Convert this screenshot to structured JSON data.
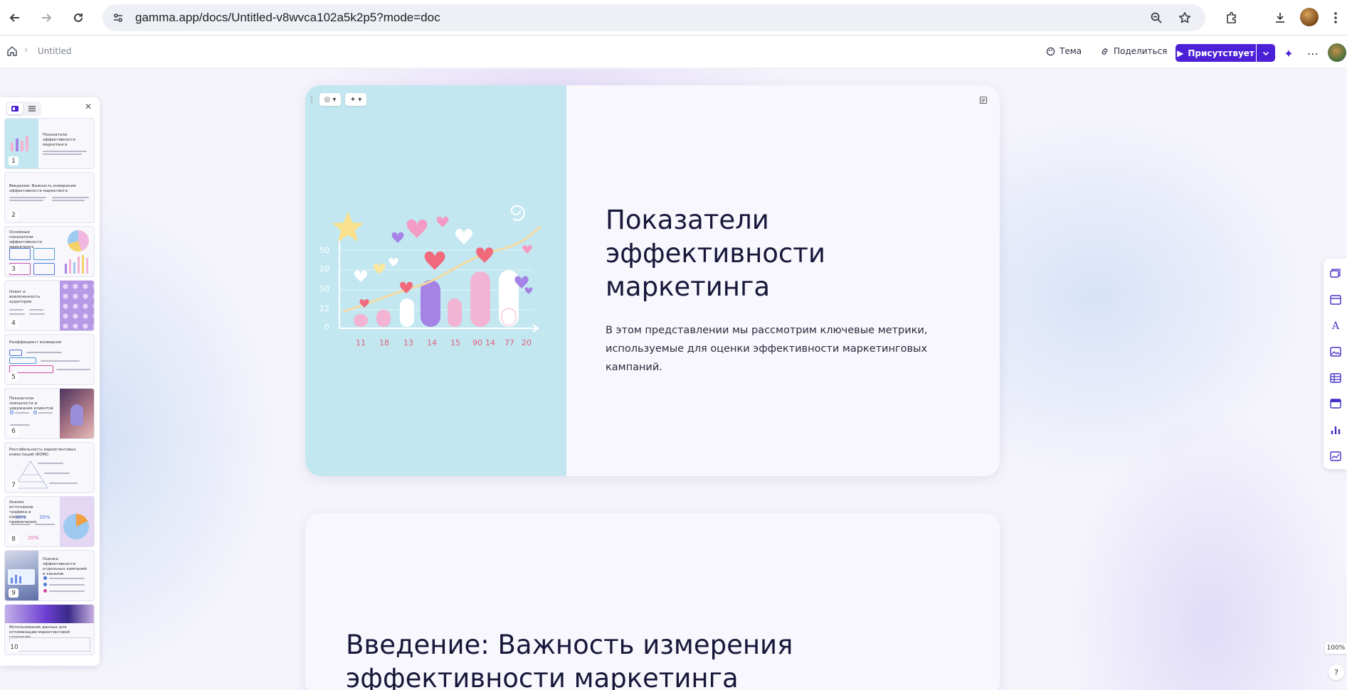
{
  "browser": {
    "url": "gamma.app/docs/Untitled-v8wvca102a5k2p5?mode=doc",
    "icons": [
      "back-icon",
      "forward-icon",
      "reload-icon",
      "site-settings-icon",
      "zoom-icon",
      "bookmark-star-icon",
      "extensions-icon",
      "download-icon",
      "profile-avatar",
      "browser-menu-icon"
    ]
  },
  "appbar": {
    "breadcrumb_title": "Untitled",
    "theme_label": "Тема",
    "share_label": "Поделиться",
    "present_label": "Присутствует"
  },
  "panel": {
    "slides": [
      {
        "num": "1",
        "title": "Показатели эффективности маркетинга"
      },
      {
        "num": "2",
        "title": "Введение: Важность измерения эффективности маркетинга"
      },
      {
        "num": "3",
        "title": "Основные показатели эффективности маркетинга"
      },
      {
        "num": "4",
        "title": "Охват и вовлеченность аудитории"
      },
      {
        "num": "5",
        "title": "Коэффициент конверсии"
      },
      {
        "num": "6",
        "title": "Показатели лояльности и удержания клиентов"
      },
      {
        "num": "7",
        "title": "Рентабельность маркетинговых инвестиций (ROMI)"
      },
      {
        "num": "8",
        "title": "Анализ источников трафика и каналов привлечения",
        "stats": [
          "50%",
          "30%",
          "20%"
        ]
      },
      {
        "num": "9",
        "title": "Оценка эффективности отдельных кампаний и каналов"
      },
      {
        "num": "10",
        "title": "Использование данных для оптимизации маркетинговой стратегии"
      }
    ]
  },
  "slide1": {
    "title_lines": [
      "Показатели",
      "эффективности",
      "маркетинга"
    ],
    "description_lines": [
      "В этом представлении мы рассмотрим ключевые метрики,",
      "используемые для оценки эффективности маркетинговых кампаний."
    ],
    "illustration": {
      "y_ticks": [
        "50",
        "20",
        "50",
        "12",
        "0"
      ],
      "x_ticks": [
        "11",
        "18",
        "13",
        "14",
        "15",
        "90",
        "14",
        "77",
        "20"
      ]
    }
  },
  "slide2": {
    "title_lines": [
      "Введение: Важность измерения",
      "эффективности маркетинга"
    ]
  },
  "status": {
    "zoom": "100%",
    "help": "?"
  },
  "colors": {
    "accent": "#4b20d6",
    "image_bg": "#c2e7f0",
    "bar_purple": "#a582e6",
    "bar_pink": "#f3b3d3",
    "heart_red": "#f06a7c"
  }
}
